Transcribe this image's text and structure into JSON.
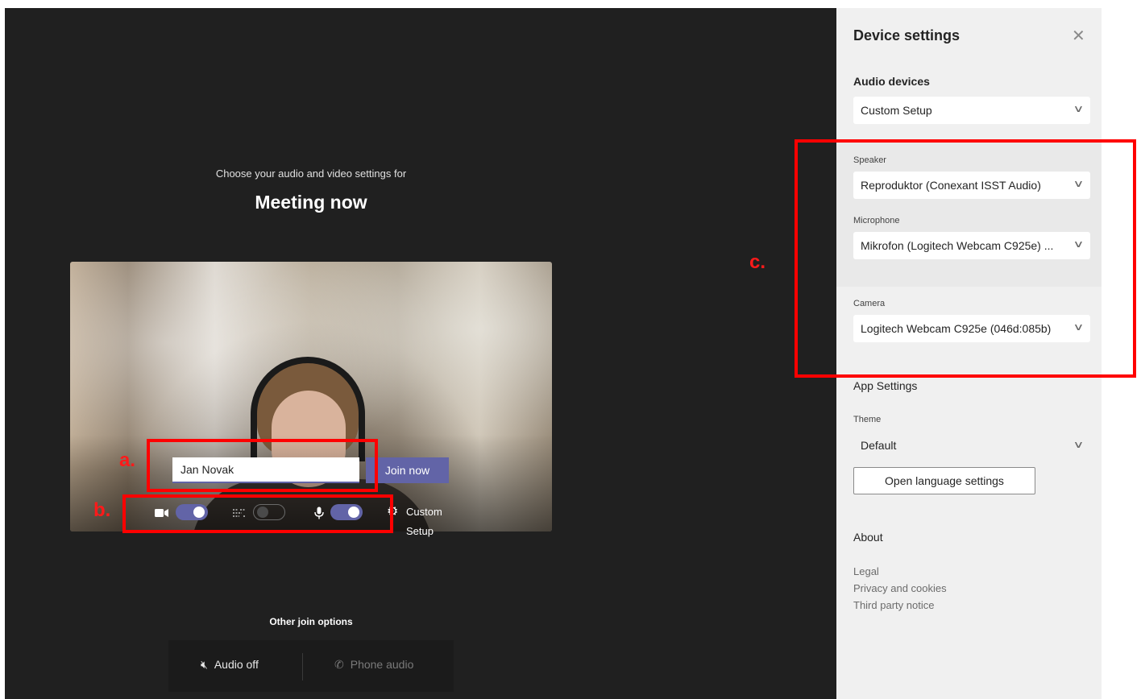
{
  "meeting": {
    "subtitle": "Choose your audio and video settings for",
    "title": "Meeting now",
    "name_value": "Jan Novak",
    "join_label": "Join now",
    "custom_setup_label": "Custom Setup",
    "other_options_label": "Other join options",
    "audio_off_label": "Audio off",
    "phone_audio_label": "Phone audio",
    "camera_on": true,
    "blur_on": false,
    "mic_on": true
  },
  "settings": {
    "title": "Device settings",
    "audio_devices_label": "Audio devices",
    "audio_devices_value": "Custom Setup",
    "speaker_label": "Speaker",
    "speaker_value": "Reproduktor (Conexant ISST Audio)",
    "microphone_label": "Microphone",
    "microphone_value": "Mikrofon (Logitech Webcam C925e) ...",
    "camera_label": "Camera",
    "camera_value": "Logitech Webcam C925e (046d:085b)",
    "app_settings_label": "App Settings",
    "theme_label": "Theme",
    "theme_value": "Default",
    "language_button_label": "Open language settings",
    "about_label": "About",
    "links": [
      "Legal",
      "Privacy and cookies",
      "Third party notice"
    ]
  },
  "annotations": {
    "a": "a.",
    "b": "b.",
    "c": "c."
  },
  "colors": {
    "accent": "#6264a7",
    "annotation": "#ff0000",
    "dark_bg": "#202020",
    "panel_bg": "#f0f0f0"
  }
}
